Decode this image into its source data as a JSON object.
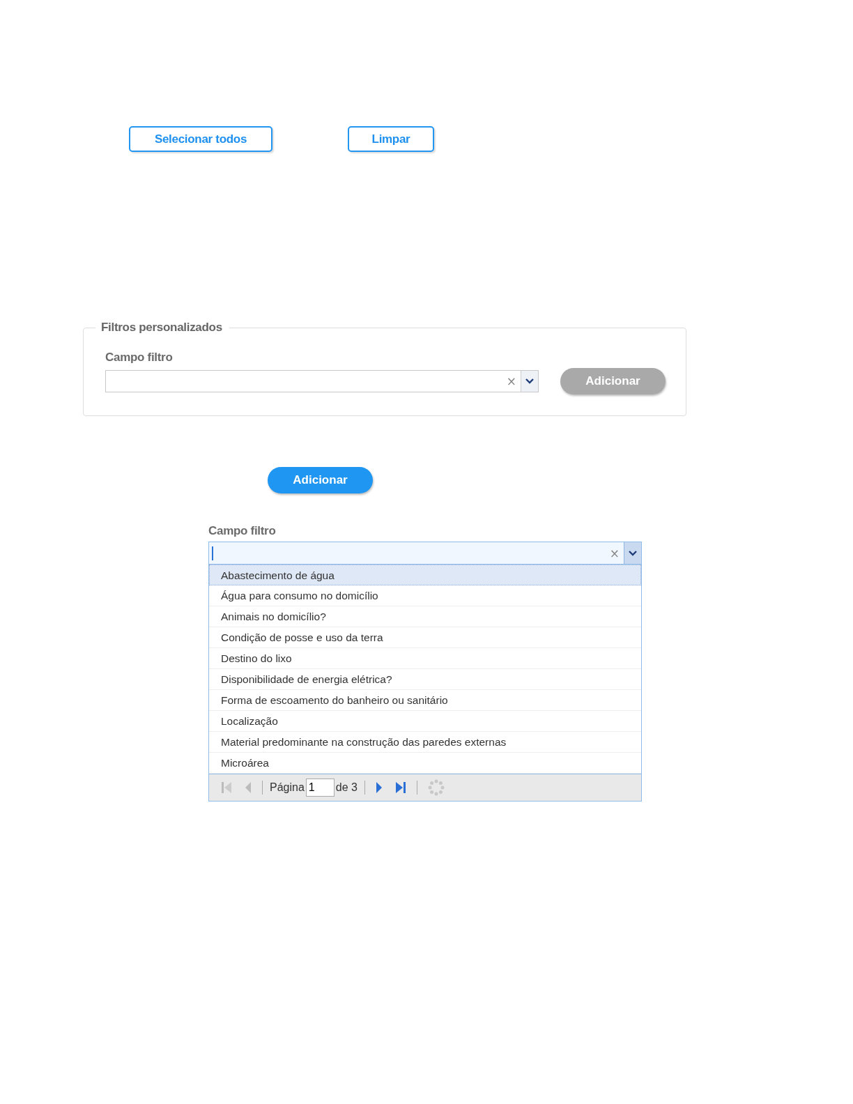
{
  "top_buttons": [
    "Selecionar todos",
    "Limpar"
  ],
  "custom_filters": {
    "legend": "Filtros personalizados",
    "field_label": "Campo filtro",
    "clear": "×",
    "add_button": {
      "label": "Adicionar",
      "disabled": true
    }
  },
  "add_button": {
    "label": "Adicionar",
    "disabled": false
  },
  "combo": {
    "label": "Campo filtro",
    "clear": "×",
    "options": [
      {
        "label": "Abastecimento de água",
        "selected": true
      },
      {
        "label": "Água para consumo no domicílio",
        "selected": false
      },
      {
        "label": "Animais no domicílio?",
        "selected": false
      },
      {
        "label": "Condição de posse e uso da terra",
        "selected": false
      },
      {
        "label": "Destino do lixo",
        "selected": false
      },
      {
        "label": "Disponibilidade de energia elétrica?",
        "selected": false
      },
      {
        "label": "Forma de escoamento do banheiro ou sanitário",
        "selected": false
      },
      {
        "label": "Localização",
        "selected": false
      },
      {
        "label": "Material predominante na construção das paredes externas",
        "selected": false
      },
      {
        "label": "Microárea",
        "selected": false
      }
    ],
    "pager": {
      "page_label": "Página",
      "page": "1",
      "of_label": "de 3"
    }
  }
}
